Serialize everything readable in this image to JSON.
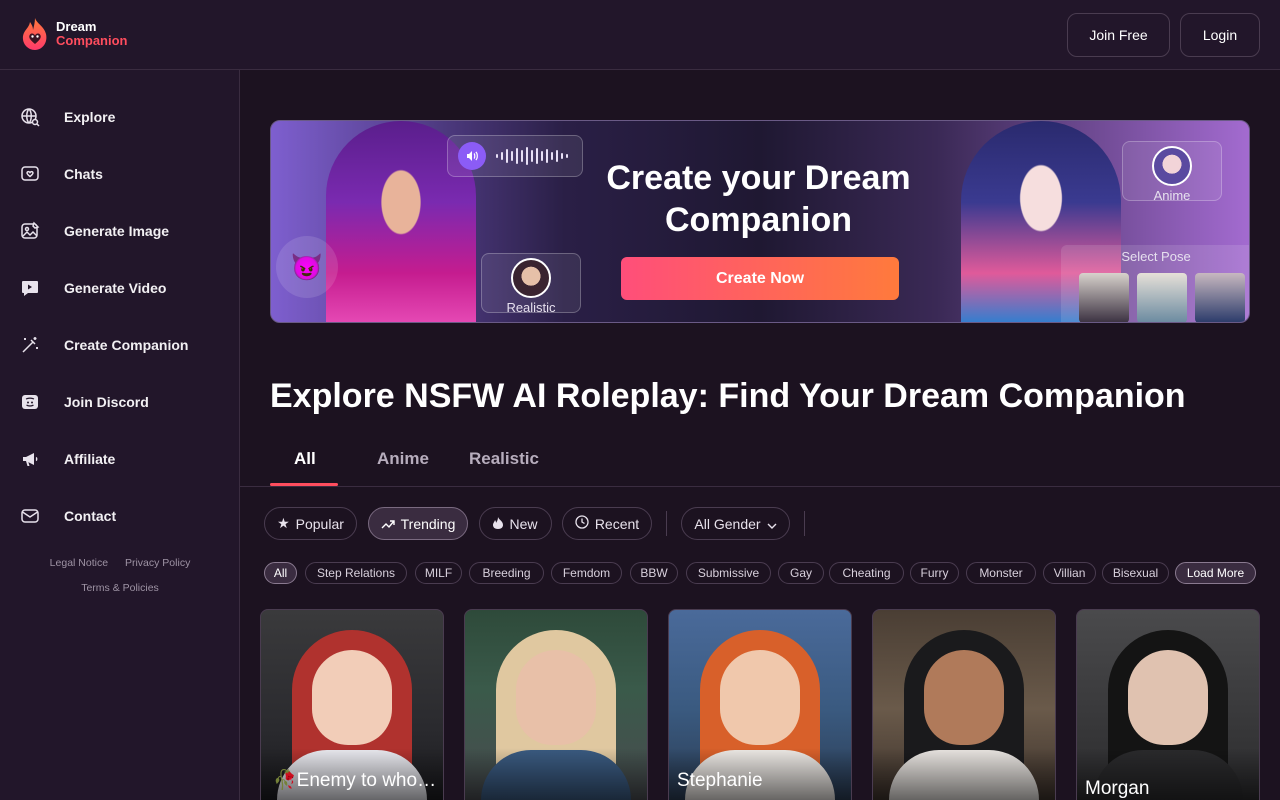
{
  "header": {
    "logo_line1": "Dream",
    "logo_line2": "Companion",
    "join_label": "Join Free",
    "login_label": "Login"
  },
  "sidebar": {
    "items": [
      {
        "label": "Explore",
        "icon": "globe-search-icon"
      },
      {
        "label": "Chats",
        "icon": "chat-heart-icon"
      },
      {
        "label": "Generate Image",
        "icon": "image-edit-icon"
      },
      {
        "label": "Generate Video",
        "icon": "video-chat-icon"
      },
      {
        "label": "Create Companion",
        "icon": "magic-wand-icon"
      },
      {
        "label": "Join Discord",
        "icon": "discord-icon"
      },
      {
        "label": "Affiliate",
        "icon": "megaphone-icon"
      },
      {
        "label": "Contact",
        "icon": "mail-heart-icon"
      }
    ],
    "footer": {
      "legal": "Legal Notice",
      "privacy": "Privacy Policy",
      "terms": "Terms & Policies"
    }
  },
  "banner": {
    "title": "Create your Dream Companion",
    "cta": "Create Now",
    "realistic_label": "Realistic",
    "anime_label": "Anime",
    "pose_label": "Select Pose",
    "emoji": "😈"
  },
  "page_title": "Explore NSFW AI Roleplay: Find Your Dream Companion",
  "tabs": [
    {
      "label": "All",
      "active": true
    },
    {
      "label": "Anime",
      "active": false
    },
    {
      "label": "Realistic",
      "active": false
    }
  ],
  "filters": {
    "popular": "Popular",
    "trending": "Trending",
    "new": "New",
    "recent": "Recent",
    "gender": "All Gender"
  },
  "chips": [
    "All",
    "Step Relations",
    "MILF",
    "Breeding",
    "Femdom",
    "BBW",
    "Submissive",
    "Gay",
    "Cheating",
    "Furry",
    "Monster",
    "Villian",
    "Bisexual"
  ],
  "load_more": "Load More",
  "cards": [
    {
      "name": "Enemy to whor…",
      "emoji": "🥀"
    },
    {
      "name": ""
    },
    {
      "name": "Stephanie"
    },
    {
      "name": ""
    },
    {
      "name": "Morgan"
    }
  ],
  "colors": {
    "accent": "#ff4d5e",
    "bg": "#1c1220",
    "panel": "#22162a",
    "border": "#3a2c40"
  }
}
